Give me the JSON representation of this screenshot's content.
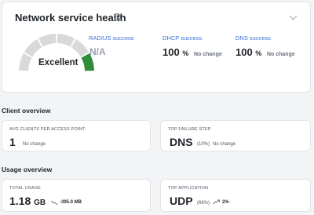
{
  "health": {
    "title": "Network service health",
    "info_icon": "info-icon",
    "collapse_icon": "chevron-down-icon",
    "gauge_label": "Excellent",
    "gauge_level_segments_lit": 1,
    "gauge_segments_total": 6,
    "colors": {
      "lit": "#2f8c3a",
      "unlit": "#d9d9d9"
    },
    "metrics": [
      {
        "label": "RADIUS success",
        "value": "N/A",
        "unit": "",
        "change": ""
      },
      {
        "label": "DHCP success",
        "value": "100",
        "unit": "%",
        "change": "No change"
      },
      {
        "label": "DNS success",
        "value": "100",
        "unit": "%",
        "change": "No change"
      }
    ]
  },
  "client_overview": {
    "title": "Client overview",
    "cards": [
      {
        "label": "AVG CLIENTS PER ACCESS POINT",
        "value": "1",
        "detail": "",
        "change": "No change"
      },
      {
        "label": "TOP FAILURE STEP",
        "value": "DNS",
        "detail": "(10%)",
        "change": "No change"
      }
    ]
  },
  "usage_overview": {
    "title": "Usage overview",
    "cards": [
      {
        "label": "TOTAL USAGE",
        "value": "1.18",
        "unit": "GB",
        "trend_icon": "trend-down-icon",
        "change": "-395.0 MB"
      },
      {
        "label": "TOP APPLICATION",
        "value": "UDP",
        "detail": "(66%)",
        "trend_icon": "trend-up-icon",
        "change": "2%"
      }
    ]
  }
}
